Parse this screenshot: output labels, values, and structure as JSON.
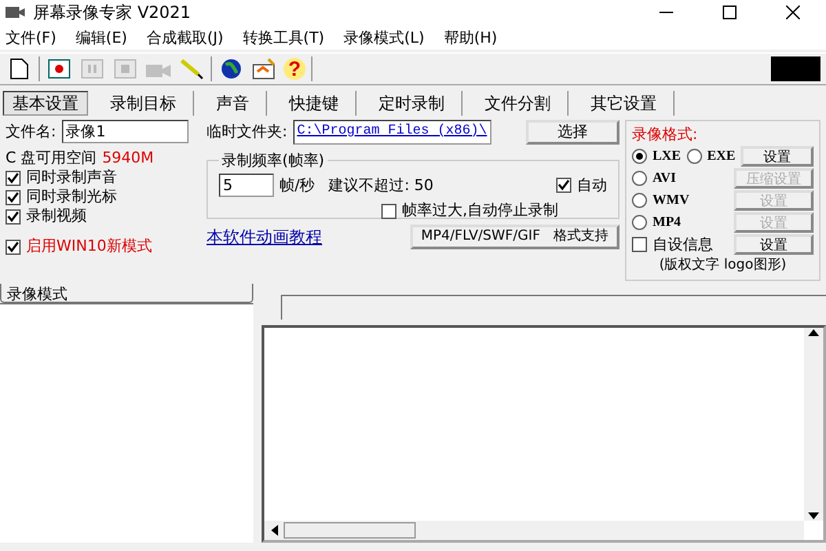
{
  "window": {
    "title": "屏幕录像专家 V2021"
  },
  "menu": [
    "文件(F)",
    "编辑(E)",
    "合成截取(J)",
    "转换工具(T)",
    "录像模式(L)",
    "帮助(H)"
  ],
  "toolbar": [
    {
      "kind": "new",
      "disabled": false
    },
    {
      "kind": "record",
      "disabled": false
    },
    {
      "kind": "pause",
      "disabled": true
    },
    {
      "kind": "stop",
      "disabled": true
    },
    {
      "kind": "camera",
      "disabled": true
    },
    {
      "kind": "pen",
      "disabled": false
    },
    {
      "kind": "globe",
      "disabled": false
    },
    {
      "kind": "paint",
      "disabled": false
    },
    {
      "kind": "help",
      "disabled": false,
      "label": "?"
    }
  ],
  "tabs": [
    {
      "label": "基本设置",
      "selected": true
    },
    {
      "label": "录制目标",
      "selected": false
    },
    {
      "label": "声音",
      "selected": false
    },
    {
      "label": "快捷键",
      "selected": false
    },
    {
      "label": "定时录制",
      "selected": false
    },
    {
      "label": "文件分割",
      "selected": false
    },
    {
      "label": "其它设置",
      "selected": false
    }
  ],
  "filename": {
    "label": "文件名:",
    "value": "录像1"
  },
  "temp_folder": {
    "label": "临时文件夹:",
    "value": "C:\\Program Files (x86)\\",
    "button": "选择"
  },
  "disk": {
    "label": "C 盘可用空间",
    "value": "5940M"
  },
  "options": [
    {
      "label": "同时录制声音",
      "checked": true
    },
    {
      "label": "同时录制光标",
      "checked": true
    },
    {
      "label": "录制视频",
      "checked": true
    }
  ],
  "win10": {
    "label": "启用WIN10新模式",
    "checked": true
  },
  "frame_rate": {
    "legend": "录制频率(帧率)",
    "value": "5",
    "unit": "帧/秒",
    "hint": "建议不超过: 50",
    "auto": {
      "label": "自动",
      "checked": true
    },
    "stop": {
      "label": "帧率过大,自动停止录制",
      "checked": false
    }
  },
  "tutorial_link": "本软件动画教程",
  "format_button": "MP4/FLV/SWF/GIF   格式支持",
  "format_group": {
    "title": "录像格式:",
    "rows": [
      {
        "radios": [
          {
            "label": "LXE",
            "selected": true
          },
          {
            "label": "EXE",
            "selected": false
          }
        ],
        "button": "设置",
        "disabled": false
      },
      {
        "radios": [
          {
            "label": "AVI",
            "selected": false
          }
        ],
        "button": "压缩设置",
        "disabled": true
      },
      {
        "radios": [
          {
            "label": "WMV",
            "selected": false
          }
        ],
        "button": "设置",
        "disabled": true
      },
      {
        "radios": [
          {
            "label": "MP4",
            "selected": false
          }
        ],
        "button": "设置",
        "disabled": true
      }
    ],
    "custom": {
      "label": "自设信息",
      "checked": false,
      "button": "设置"
    },
    "note": "(版权文字 logo图形)"
  },
  "bottom_tab": "录像模式"
}
